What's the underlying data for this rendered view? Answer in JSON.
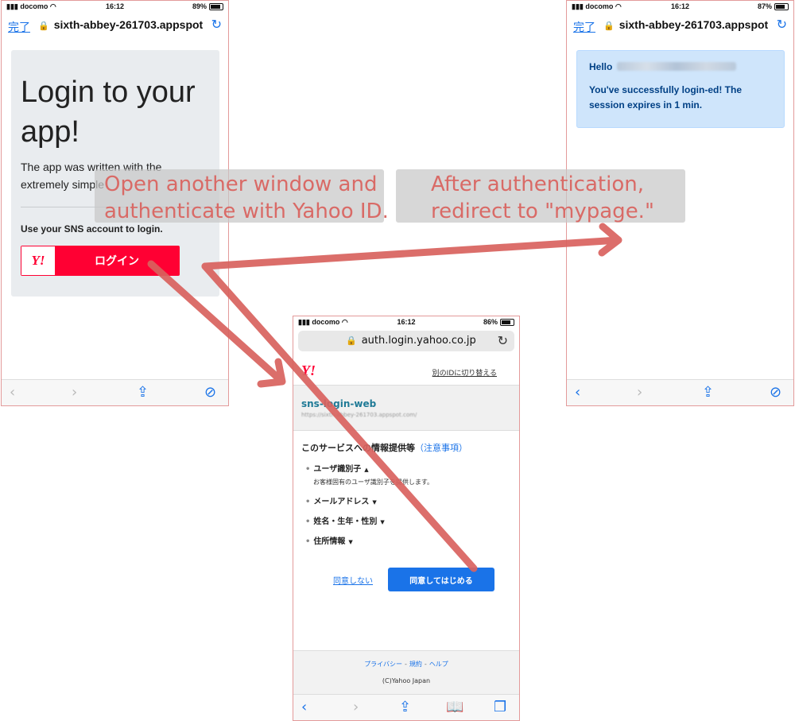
{
  "phone_login": {
    "status": {
      "carrier": "docomo",
      "time": "16:12",
      "battery": "89%",
      "battery_level": 0.89
    },
    "address": {
      "done_label": "完了",
      "url": "sixth-abbey-261703.appspot"
    },
    "card": {
      "heading": "Login to your app!",
      "lead": "The app was written with the extremely simple",
      "sns_label": "Use your SNS account to login.",
      "yahoo_logo_text": "Y!",
      "login_button_label": "ログイン"
    }
  },
  "phone_mypage": {
    "status": {
      "carrier": "docomo",
      "time": "16:12",
      "battery": "87%",
      "battery_level": 0.87
    },
    "address": {
      "done_label": "完了",
      "url": "sixth-abbey-261703.appspot"
    },
    "alert": {
      "hello": "Hello",
      "message": "You've successfully login-ed! The session expires in 1 min."
    }
  },
  "phone_auth": {
    "status": {
      "carrier": "docomo",
      "time": "16:12",
      "battery": "86%",
      "battery_level": 0.86
    },
    "address": {
      "url": "auth.login.yahoo.co.jp"
    },
    "header": {
      "logo_text": "Y!",
      "switch_id_label": "別のIDに切り替える"
    },
    "app": {
      "name": "sns-login-web",
      "url": "https://sixth-abbey-261703.appspot.com/"
    },
    "consent": {
      "title": "このサービスへの情報提供等",
      "note_open": "（",
      "note": "注意事項",
      "note_close": "）",
      "items": [
        {
          "label": "ユーザ識別子",
          "caret": "▲",
          "description": "お客様固有のユーザ識別子を提供します。"
        },
        {
          "label": "メールアドレス",
          "caret": "▼"
        },
        {
          "label": "姓名・生年・性別",
          "caret": "▼"
        },
        {
          "label": "住所情報",
          "caret": "▼"
        }
      ],
      "deny_label": "同意しない",
      "agree_label": "同意してはじめる"
    },
    "footer": {
      "privacy": "プライバシー",
      "terms": "規約",
      "help": "ヘルプ",
      "separator": "-",
      "copyright": "(C)Yahoo Japan"
    }
  },
  "captions": {
    "left": [
      "Open another window and",
      "authenticate with Yahoo ID."
    ],
    "right": [
      "After authentication,",
      "redirect to \"mypage.\""
    ]
  },
  "colors": {
    "yahoo_red": "#ff0033",
    "ios_blue": "#1a73e8",
    "arrow": "#d9625e",
    "alert_bg": "#cfe5fb",
    "alert_text": "#004085",
    "card_bg": "#e9ecef"
  },
  "icons": {
    "back": "chevron-left-icon",
    "forward": "chevron-right-icon",
    "share": "share-icon",
    "safari": "compass-icon",
    "bookmarks": "book-icon",
    "tabs": "tabs-icon",
    "reload": "reload-icon",
    "lock": "lock-icon"
  }
}
